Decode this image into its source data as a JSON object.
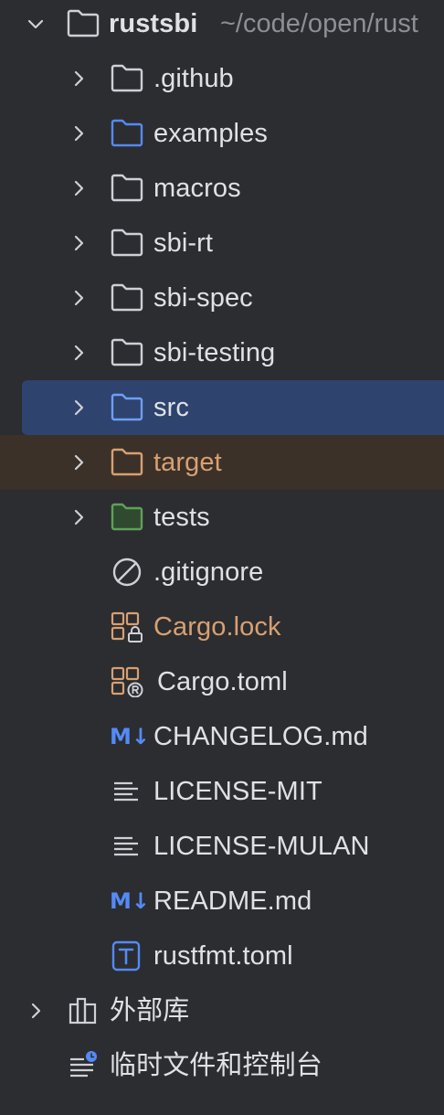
{
  "project": {
    "name": "rustsbi",
    "path": "~/code/open/rust"
  },
  "tree": {
    "github": ".github",
    "examples": "examples",
    "macros": "macros",
    "sbi_rt": "sbi-rt",
    "sbi_spec": "sbi-spec",
    "sbi_testing": "sbi-testing",
    "src": "src",
    "target": "target",
    "tests": "tests",
    "gitignore": ".gitignore",
    "cargo_lock": "Cargo.lock",
    "cargo_toml": "Cargo.toml",
    "changelog": "CHANGELOG.md",
    "license_mit": "LICENSE-MIT",
    "license_mulan": "LICENSE-MULAN",
    "readme": "README.md",
    "rustfmt": "rustfmt.toml"
  },
  "badges": {
    "markdown": "M↓"
  },
  "external_libraries": "外部库",
  "scratches": "临时文件和控制台",
  "colors": {
    "background": "#2b2d30",
    "selected": "#2e436e",
    "excluded": "#3b3128",
    "text": "#dfe1e5",
    "orange": "#d8a072",
    "blue_folder": "#548af7",
    "green_folder": "#5fa05a"
  }
}
